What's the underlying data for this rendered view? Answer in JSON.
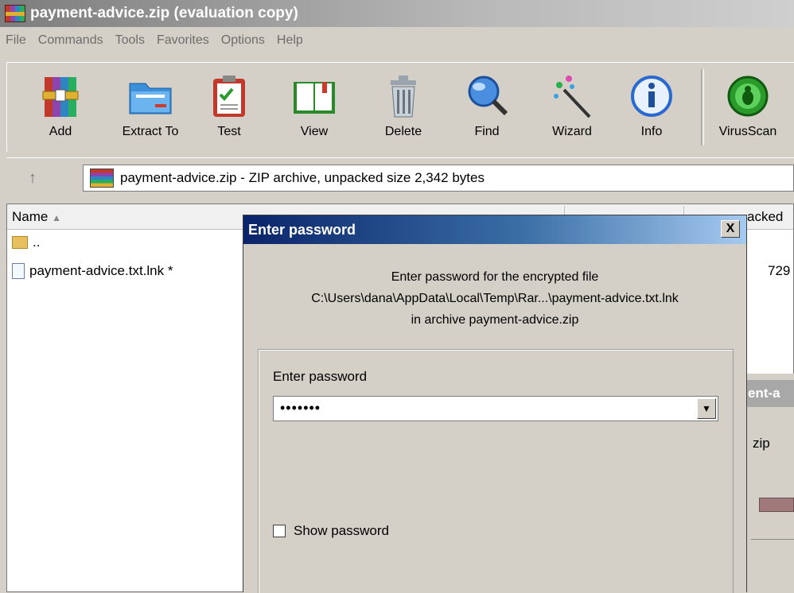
{
  "window": {
    "title": "payment-advice.zip (evaluation copy)"
  },
  "menu": [
    "File",
    "Commands",
    "Tools",
    "Favorites",
    "Options",
    "Help"
  ],
  "toolbar": [
    "Add",
    "Extract To",
    "Test",
    "View",
    "Delete",
    "Find",
    "Wizard",
    "Info",
    "VirusScan"
  ],
  "address": {
    "text": "payment-advice.zip - ZIP archive, unpacked size 2,342 bytes"
  },
  "list": {
    "headers": {
      "name": "Name",
      "packed": "acked"
    },
    "rows": [
      {
        "name": ".."
      },
      {
        "name": "payment-advice.txt.lnk *",
        "size": "729"
      }
    ]
  },
  "background_dialog": {
    "title_fragment": "ent-a",
    "text_fragment": "zip"
  },
  "password_dialog": {
    "title": "Enter password",
    "close": "X",
    "message_line1": "Enter password for the encrypted file",
    "message_line2": "C:\\Users\\dana\\AppData\\Local\\Temp\\Rar...\\payment-advice.txt.lnk",
    "message_line3": "in archive payment-advice.zip",
    "field_label": "Enter password",
    "password_value": "•••••••",
    "show_password_label": "Show password",
    "show_password_checked": false
  }
}
